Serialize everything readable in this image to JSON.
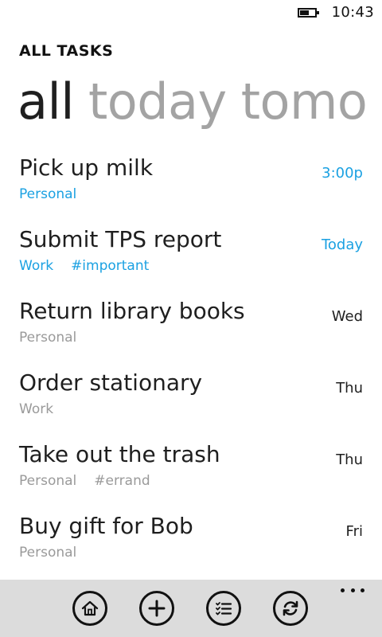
{
  "status_bar": {
    "time": "10:43",
    "battery_level": 0.6
  },
  "header": {
    "app_title": "ALL TASKS"
  },
  "pivot": {
    "items": [
      "all",
      "today",
      "tomo"
    ],
    "active_index": 0
  },
  "tasks": [
    {
      "title": "Pick up milk",
      "tags": [
        "Personal"
      ],
      "when": "3:00p",
      "highlight": true
    },
    {
      "title": "Submit TPS report",
      "tags": [
        "Work",
        "#important"
      ],
      "when": "Today",
      "highlight": true
    },
    {
      "title": "Return library books",
      "tags": [
        "Personal"
      ],
      "when": "Wed",
      "highlight": false
    },
    {
      "title": "Order stationary",
      "tags": [
        "Work"
      ],
      "when": "Thu",
      "highlight": false
    },
    {
      "title": "Take out the trash",
      "tags": [
        "Personal",
        "#errand"
      ],
      "when": "Thu",
      "highlight": false
    },
    {
      "title": "Buy gift for Bob",
      "tags": [
        "Personal"
      ],
      "when": "Fri",
      "highlight": false
    }
  ],
  "app_bar": {
    "buttons": [
      "home-icon",
      "add-icon",
      "checklist-icon",
      "sync-icon"
    ],
    "more_icon": "ellipsis-icon"
  },
  "colors": {
    "accent": "#1ba1e2",
    "muted": "#9a9a9a",
    "app_bar_bg": "#dcdcdc"
  }
}
